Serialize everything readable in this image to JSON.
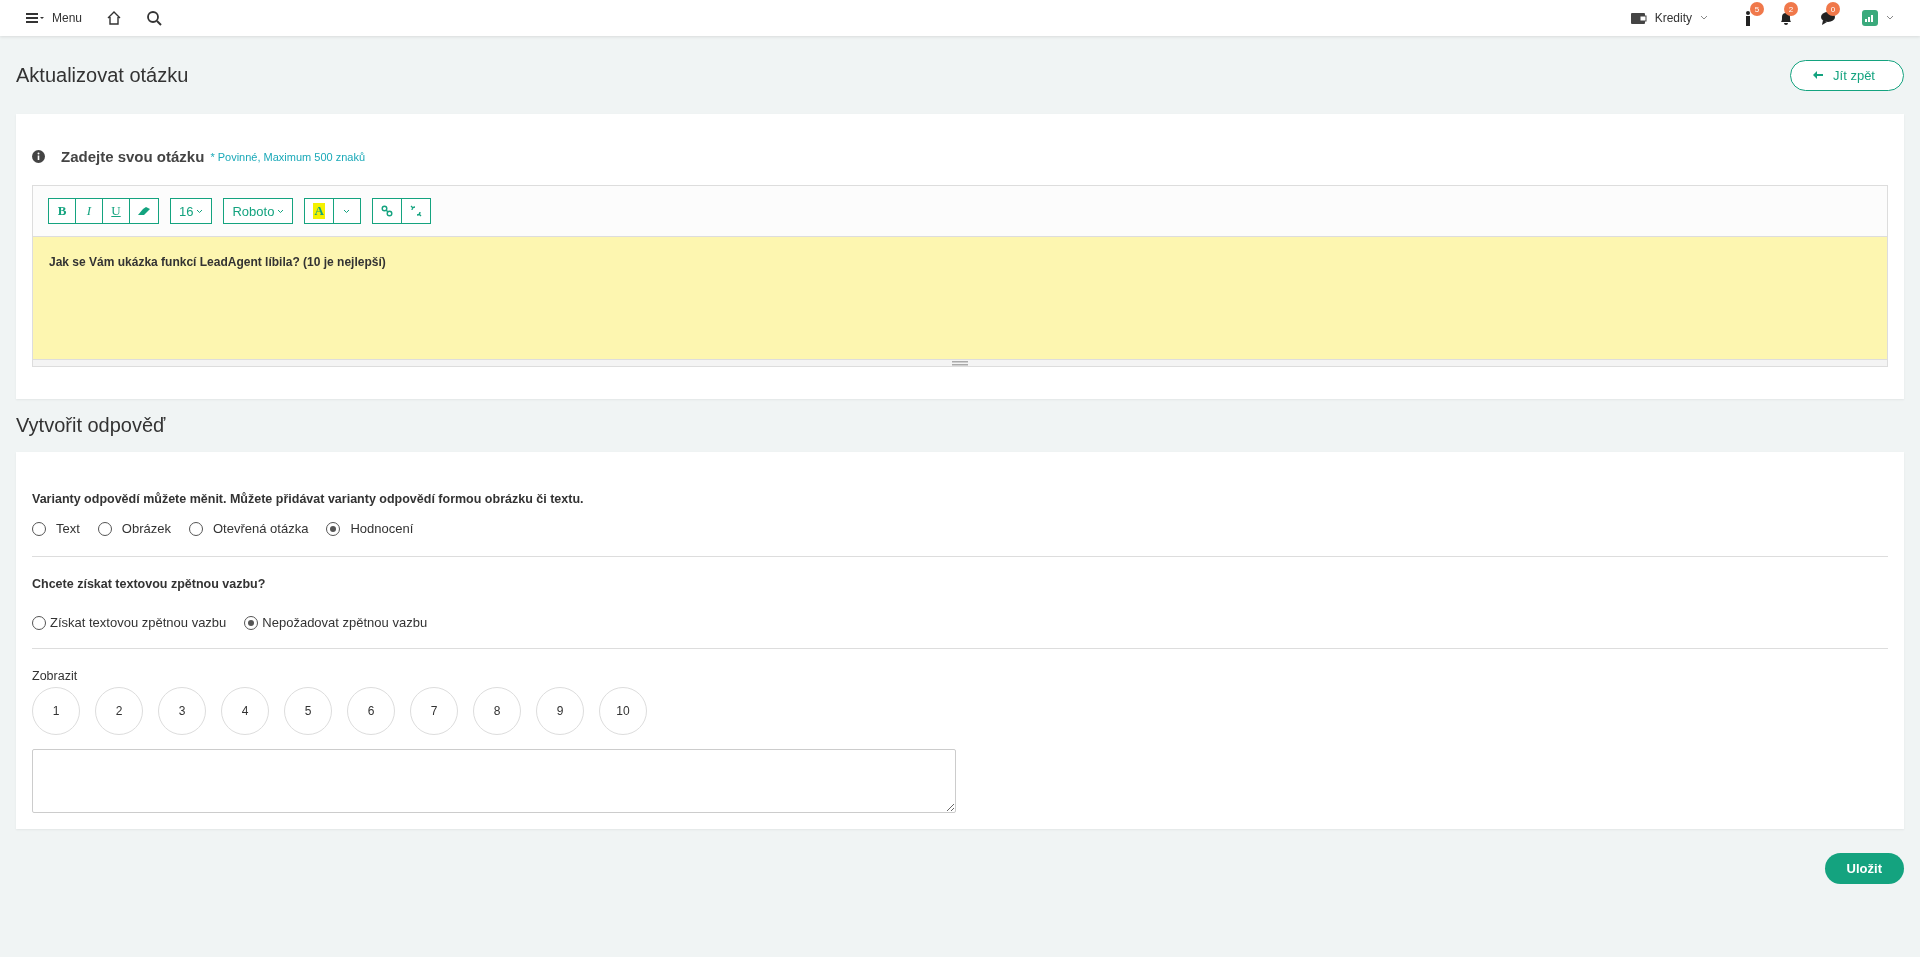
{
  "topbar": {
    "menu_label": "Menu",
    "credits_label": "Kredity",
    "notifications": [
      {
        "kind": "person",
        "count": "5"
      },
      {
        "kind": "bell",
        "count": "2"
      },
      {
        "kind": "chat",
        "count": "0"
      }
    ]
  },
  "page_title": "Aktualizovat otázku",
  "back_button": "Jít zpět",
  "question": {
    "label": "Zadejte svou otázku",
    "hint": "* Povinné, Maximum 500 znaků",
    "toolbar": [
      [
        {
          "kind": "bold",
          "label": "B"
        },
        {
          "kind": "italic",
          "label": "I"
        },
        {
          "kind": "underline",
          "label": "U"
        },
        {
          "kind": "eraser"
        }
      ],
      [
        {
          "kind": "size",
          "label": "16"
        }
      ],
      [
        {
          "kind": "font",
          "label": "Roboto"
        }
      ],
      [
        {
          "kind": "color",
          "label": "A"
        },
        {
          "kind": "caret"
        }
      ],
      [
        {
          "kind": "link"
        },
        {
          "kind": "unlink"
        }
      ]
    ],
    "content": "Jak se Vám ukázka funkcí LeadAgent líbila? (10 je nejlepší)"
  },
  "answer_title": "Vytvořit odpověď",
  "answer": {
    "instructions": "Varianty odpovědí můžete měnit. Můžete přidávat varianty odpovědí formou obrázku či textu.",
    "types": [
      {
        "label": "Text",
        "selected": false
      },
      {
        "label": "Obrázek",
        "selected": false
      },
      {
        "label": "Otevřená otázka",
        "selected": false
      },
      {
        "label": "Hodnocení",
        "selected": true
      }
    ],
    "feedback_question": "Chcete získat textovou zpětnou vazbu?",
    "feedback_options": [
      {
        "label": "Získat textovou zpětnou vazbu",
        "selected": false
      },
      {
        "label": "Nepožadovat zpětnou vazbu",
        "selected": true
      }
    ],
    "display_label": "Zobrazit",
    "scale": [
      "1",
      "2",
      "3",
      "4",
      "5",
      "6",
      "7",
      "8",
      "9",
      "10"
    ]
  },
  "save_button": "Uložit"
}
